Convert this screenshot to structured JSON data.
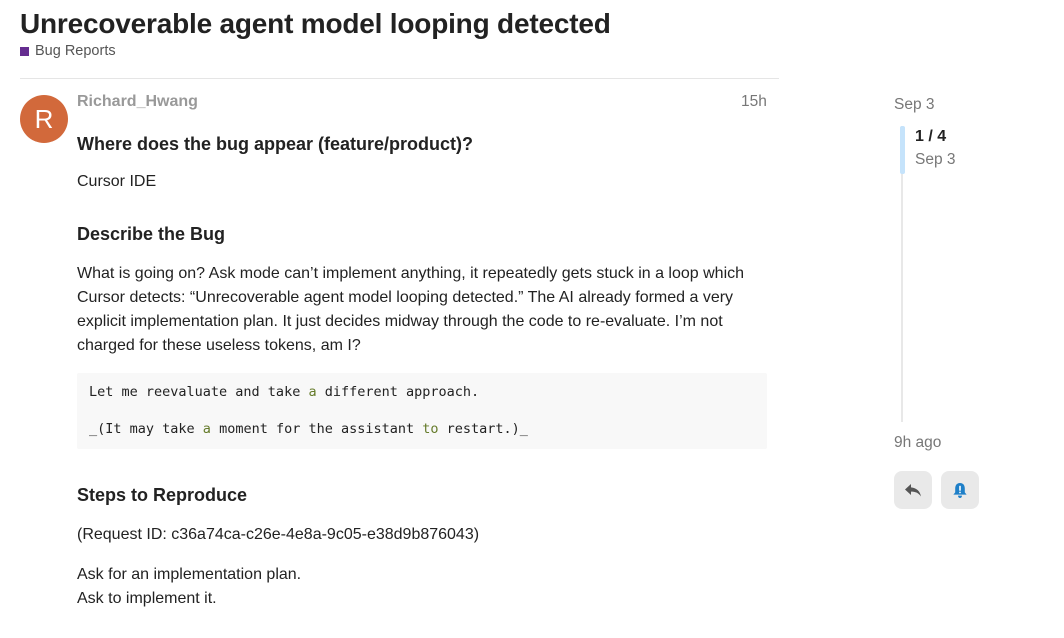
{
  "topic": {
    "title": "Unrecoverable agent model looping detected",
    "category": "Bug Reports",
    "category_color": "#652d90"
  },
  "post": {
    "avatar_letter": "R",
    "avatar_color": "#d2693b",
    "username": "Richard_Hwang",
    "age": "15h",
    "heading_where": "Where does the bug appear (feature/product)?",
    "where_answer": "Cursor IDE",
    "heading_describe": "Describe the Bug",
    "description": "What is going on? Ask mode can’t implement anything, it repeatedly gets stuck in a loop which Cursor detects: “Unrecoverable agent model looping detected.” The AI already formed a very explicit implementation plan. It just decides midway through the code to re-evaluate. I’m not charged for these useless tokens, am I?",
    "code": {
      "line1": {
        "pre": "Let me reevaluate and take ",
        "kw": "a",
        "post": " different approach."
      },
      "line2": {
        "p1": "_(It may take ",
        "kw1": "a",
        "p2": " moment for the assistant ",
        "kw2": "to",
        "p3": " restart.)_"
      }
    },
    "heading_steps": "Steps to Reproduce",
    "request_id": "(Request ID: c36a74ca-c26e-4e8a-9c05-e38d9b876043)",
    "step1": "Ask for an implementation plan.",
    "step2": "Ask to implement it."
  },
  "timeline": {
    "start_date": "Sep 3",
    "position": "1 / 4",
    "position_date": "Sep 3",
    "end_label": "9h ago",
    "reply_icon": "reply-icon",
    "notify_icon": "bell-alert-icon"
  }
}
